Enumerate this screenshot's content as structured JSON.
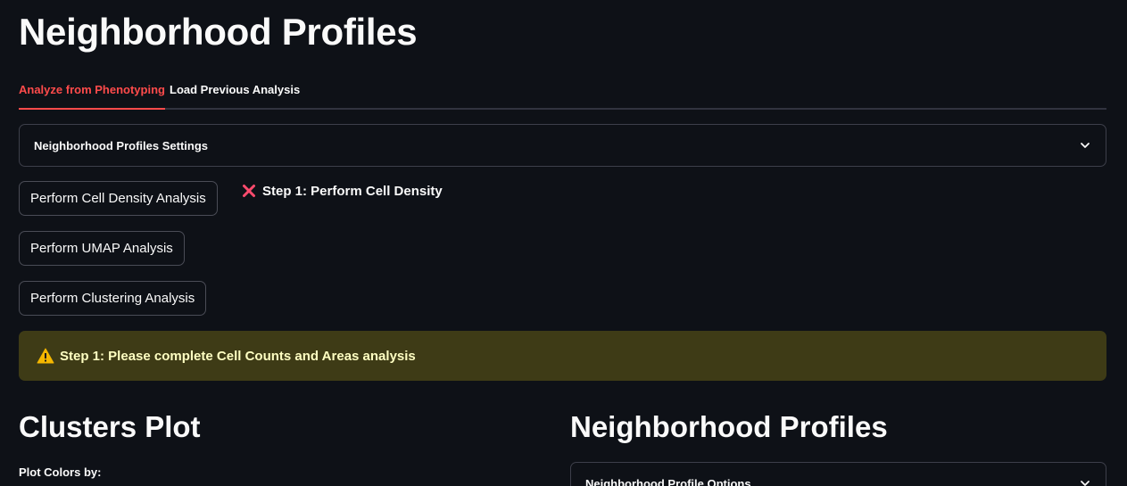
{
  "page": {
    "title": "Neighborhood Profiles"
  },
  "tabs": [
    {
      "label": "Analyze from Phenotyping",
      "active": true
    },
    {
      "label": "Load Previous Analysis",
      "active": false
    }
  ],
  "settings_expander": {
    "label": "Neighborhood Profiles Settings",
    "icon": "chevron-down-icon"
  },
  "buttons": {
    "cell_density": "Perform Cell Density Analysis",
    "umap": "Perform UMAP Analysis",
    "clustering": "Perform Clustering Analysis"
  },
  "status": {
    "icon": "x-icon",
    "text": "Step 1: Perform Cell Density",
    "color": "#ff4b6e"
  },
  "warning": {
    "icon": "warning-icon",
    "text": "Step 1: Please complete Cell Counts and Areas analysis",
    "bg": "#3e3b16",
    "color": "#ffffc2"
  },
  "clusters": {
    "heading": "Clusters Plot",
    "color_label": "Plot Colors by:"
  },
  "profiles": {
    "heading": "Neighborhood Profiles",
    "options_expander": {
      "label": "Neighborhood Profile Options",
      "icon": "chevron-down-icon"
    }
  },
  "colors": {
    "background": "#0e1117",
    "accent": "#ff4b4b"
  }
}
